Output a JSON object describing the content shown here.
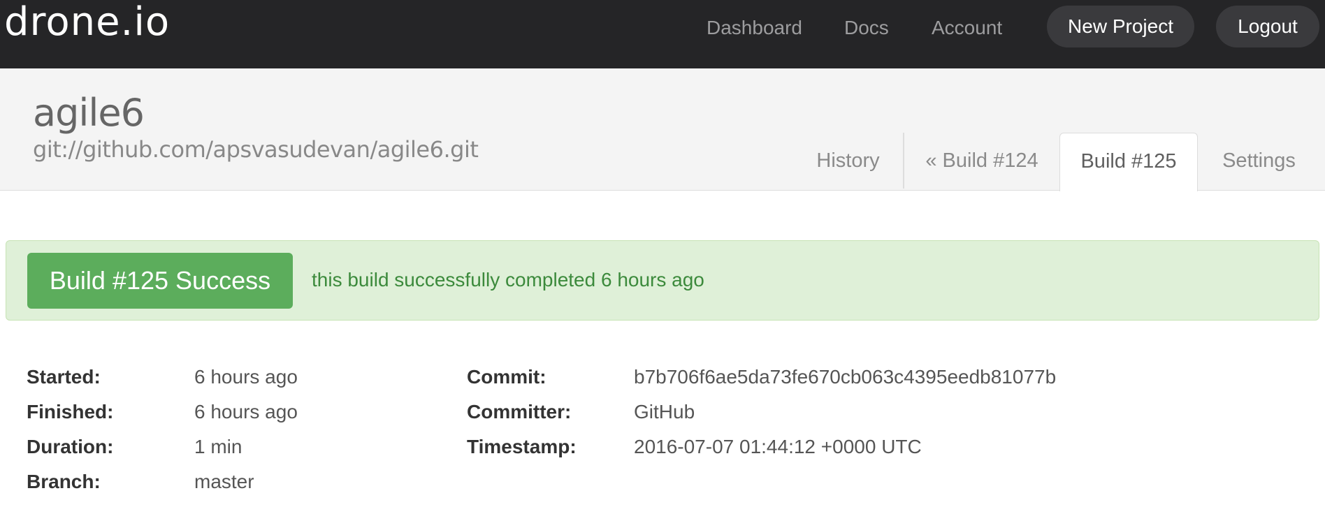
{
  "navbar": {
    "brand": "drone.io",
    "links": {
      "dashboard": "Dashboard",
      "docs": "Docs",
      "account": "Account"
    },
    "new_project": "New Project",
    "logout": "Logout",
    "background_color": "#252527"
  },
  "project": {
    "name": "agile6",
    "repo_url": "git://github.com/apsvasudevan/agile6.git"
  },
  "tabs": {
    "history": "History",
    "previous_build": "« Build #124",
    "current_build": "Build #125",
    "settings": "Settings",
    "active": "current_build"
  },
  "status": {
    "badge": "Build #125 Success",
    "message": "this build successfully completed 6 hours ago",
    "state": "success",
    "badge_color": "#5cad5c",
    "alert_color": "#dff0d8"
  },
  "details": {
    "started": {
      "label": "Started:",
      "value": "6 hours ago"
    },
    "finished": {
      "label": "Finished:",
      "value": "6 hours ago"
    },
    "duration": {
      "label": "Duration:",
      "value": "1 min"
    },
    "branch": {
      "label": "Branch:",
      "value": "master"
    },
    "commit": {
      "label": "Commit:",
      "value": "b7b706f6ae5da73fe670cb063c4395eedb81077b"
    },
    "committer": {
      "label": "Committer:",
      "value": "GitHub"
    },
    "timestamp": {
      "label": "Timestamp:",
      "value": "2016-07-07 01:44:12 +0000 UTC"
    }
  }
}
